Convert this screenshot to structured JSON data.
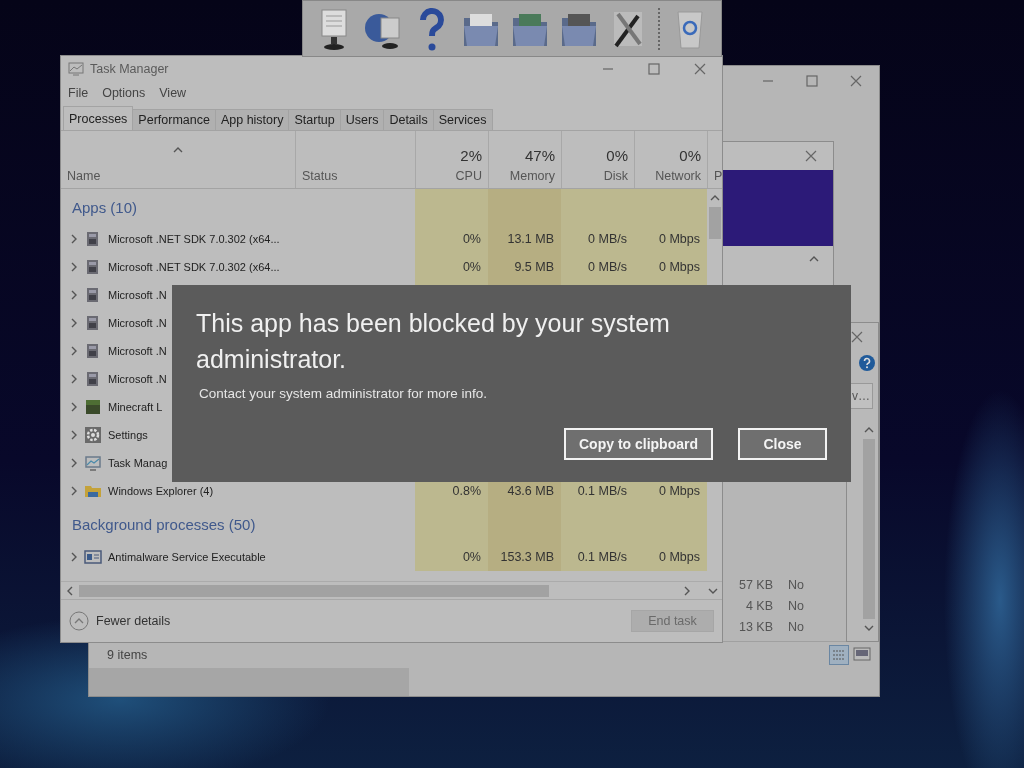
{
  "back_window": {
    "field_text": "v…",
    "list_rows": [
      {
        "size": "57 KB",
        "value": "No"
      },
      {
        "size": "4 KB",
        "value": "No"
      },
      {
        "size": "13 KB",
        "value": "No"
      }
    ],
    "status_text": "9 items"
  },
  "task_manager": {
    "title": "Task Manager",
    "menu": [
      "File",
      "Options",
      "View"
    ],
    "tabs": [
      {
        "label": "Processes",
        "selected": true
      },
      {
        "label": "Performance",
        "selected": false
      },
      {
        "label": "App history",
        "selected": false
      },
      {
        "label": "Startup",
        "selected": false
      },
      {
        "label": "Users",
        "selected": false
      },
      {
        "label": "Details",
        "selected": false
      },
      {
        "label": "Services",
        "selected": false
      }
    ],
    "columns": [
      {
        "label": "Name"
      },
      {
        "label": "Status"
      },
      {
        "percent": "2%",
        "label": "CPU"
      },
      {
        "percent": "47%",
        "label": "Memory"
      },
      {
        "percent": "0%",
        "label": "Disk"
      },
      {
        "percent": "0%",
        "label": "Network"
      },
      {
        "label": "P"
      }
    ],
    "groups": [
      {
        "title": "Apps (10)",
        "rows": [
          {
            "name": "Microsoft .NET SDK 7.0.302 (x64...",
            "cpu": "0%",
            "memory": "13.1 MB",
            "disk": "0 MB/s",
            "network": "0 Mbps"
          },
          {
            "name": "Microsoft .NET SDK 7.0.302 (x64...",
            "cpu": "0%",
            "memory": "9.5 MB",
            "disk": "0 MB/s",
            "network": "0 Mbps"
          },
          {
            "name": "Microsoft .N"
          },
          {
            "name": "Microsoft .N"
          },
          {
            "name": "Microsoft .N"
          },
          {
            "name": "Microsoft .N"
          },
          {
            "name": "Minecraft L"
          },
          {
            "name": "Settings"
          },
          {
            "name": "Task Manag"
          },
          {
            "name": "Windows Explorer (4)",
            "cpu": "0.8%",
            "memory": "43.6 MB",
            "disk": "0.1 MB/s",
            "network": "0 Mbps"
          }
        ]
      },
      {
        "title": "Background processes (50)",
        "rows": [
          {
            "name": "Antimalware Service Executable",
            "cpu": "0%",
            "memory": "153.3 MB",
            "disk": "0.1 MB/s",
            "network": "0 Mbps"
          }
        ]
      }
    ],
    "footer": {
      "toggle": "Fewer details",
      "end_task": {
        "label": "End task",
        "disabled": true
      }
    }
  },
  "dialog": {
    "title": "This app has been blocked by your system administrator.",
    "message": "Contact your system administrator for more info.",
    "buttons": [
      "Copy to clipboard",
      "Close"
    ]
  }
}
